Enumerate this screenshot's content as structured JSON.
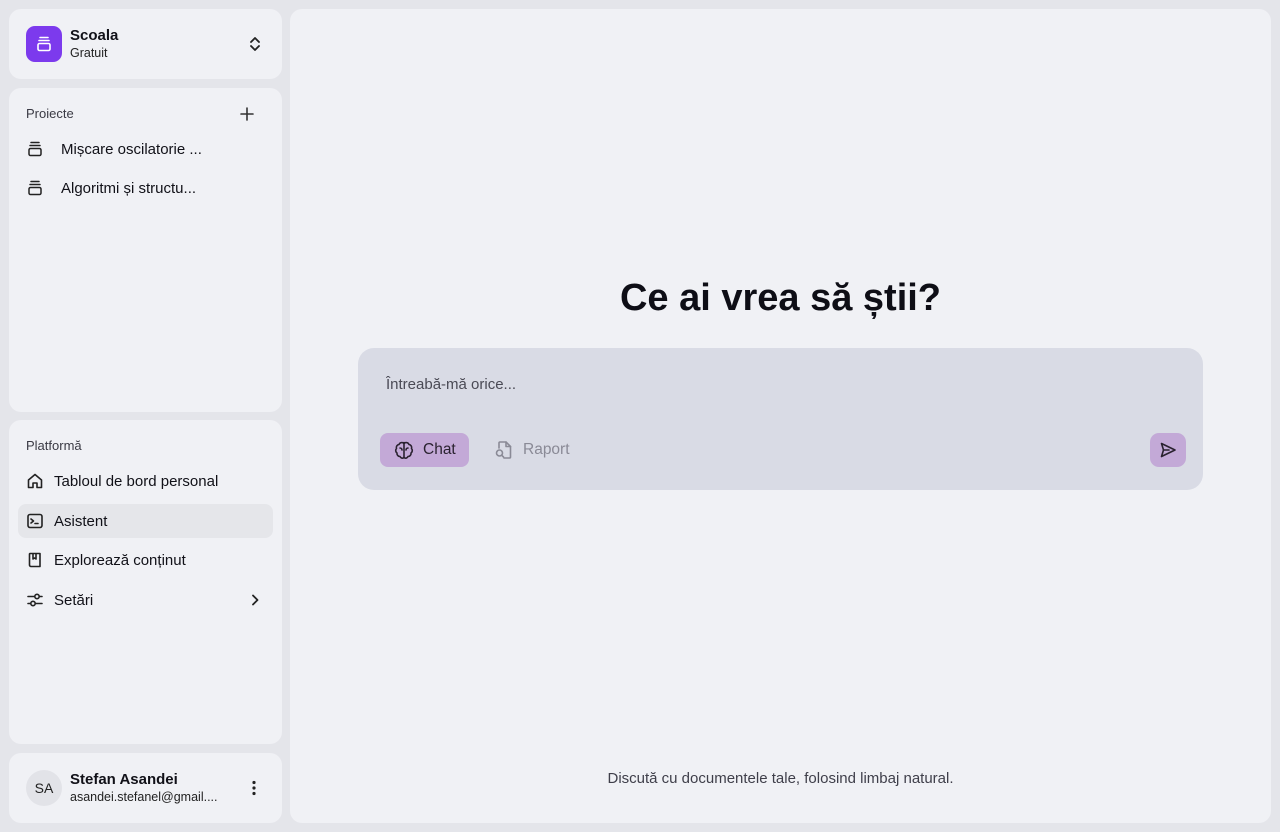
{
  "workspace": {
    "name": "Scoala",
    "plan": "Gratuit",
    "logo_color": "#7c3aed"
  },
  "projects": {
    "section_label": "Proiecte",
    "items": [
      {
        "label": "Mișcare oscilatorie ...",
        "icon": "stack-icon"
      },
      {
        "label": "Algoritmi și structu...",
        "icon": "stack-icon"
      }
    ]
  },
  "platform": {
    "section_label": "Platformă",
    "items": [
      {
        "label": "Tabloul de bord personal",
        "icon": "home-icon",
        "active": false
      },
      {
        "label": "Asistent",
        "icon": "terminal-icon",
        "active": true
      },
      {
        "label": "Explorează conținut",
        "icon": "book-icon",
        "active": false
      },
      {
        "label": "Setări",
        "icon": "sliders-icon",
        "active": false,
        "has_submenu": true
      }
    ]
  },
  "user": {
    "initials": "SA",
    "name": "Stefan Asandei",
    "email": "asandei.stefanel@gmail...."
  },
  "main": {
    "headline": "Ce ai vrea să știi?",
    "input_placeholder": "Întreabă-mă orice...",
    "modes": [
      {
        "label": "Chat",
        "icon": "brain-icon",
        "selected": true
      },
      {
        "label": "Raport",
        "icon": "file-search-icon",
        "selected": false
      }
    ],
    "send_icon": "send-icon",
    "footer_note": "Discută cu documentele tale, folosind limbaj natural."
  },
  "colors": {
    "accent": "#c3a9d7",
    "background": "#e4e5ea",
    "panel": "#f0f1f5",
    "prompt_box": "#d9dbe5"
  }
}
